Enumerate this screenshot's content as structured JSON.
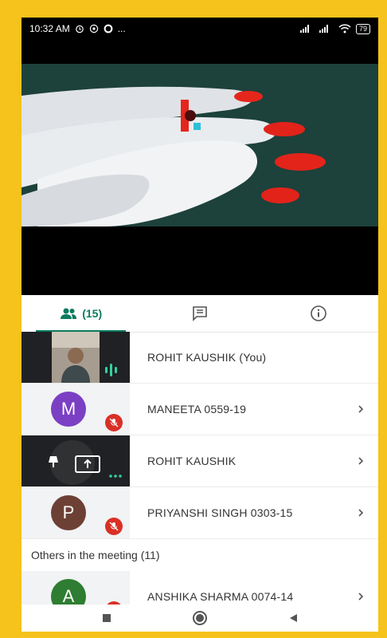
{
  "status": {
    "time": "10:32 AM",
    "indicators": [
      "alarm-icon",
      "whatsapp-icon",
      "circle-icon",
      "..."
    ],
    "battery": "79"
  },
  "tabs": [
    {
      "icon": "people-icon",
      "label": "(15)",
      "active": true
    },
    {
      "icon": "chat-icon",
      "label": "",
      "active": false
    },
    {
      "icon": "info-icon",
      "label": "",
      "active": false
    }
  ],
  "participants": [
    {
      "name": "ROHIT KAUSHIK (You)",
      "tile": "camera",
      "speaking": true
    },
    {
      "name": "MANEETA 0559-19",
      "avatar_letter": "M",
      "avatar_color": "#7b3fc4",
      "muted": true
    },
    {
      "name": "ROHIT KAUSHIK",
      "tile": "presenting"
    },
    {
      "name": "PRIYANSHI SINGH 0303-15",
      "avatar_letter": "P",
      "avatar_color": "#6d4035",
      "muted": true
    }
  ],
  "section_title": "Others in the meeting (11)",
  "others": [
    {
      "name": "ANSHIKA SHARMA 0074-14",
      "avatar_letter": "A",
      "avatar_color": "#2e7d32",
      "muted": true
    }
  ],
  "colors": {
    "accent": "#0b7a5e",
    "mute_red": "#d93025",
    "frame": "#f6c21c"
  }
}
